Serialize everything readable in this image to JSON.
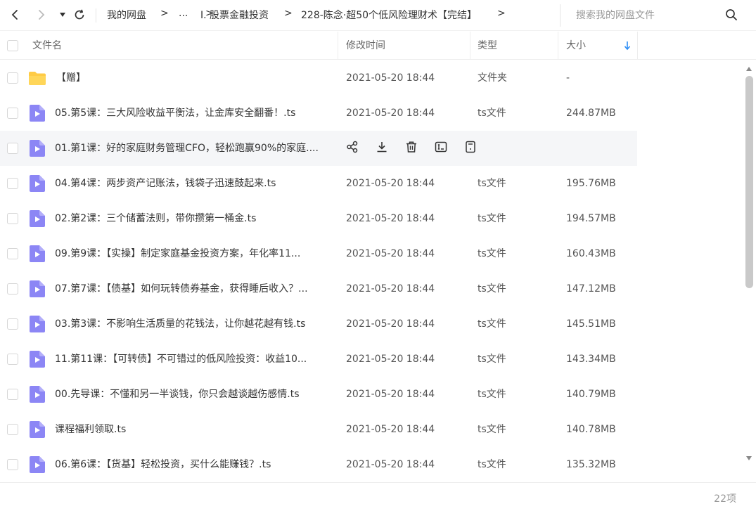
{
  "nav": {
    "breadcrumb": [
      "我的网盘",
      "...",
      "I. 股票金融投资",
      "228-陈念·超50个低风险理财术【完结】"
    ],
    "separator": ">"
  },
  "search": {
    "placeholder": "搜索我的网盘文件"
  },
  "table": {
    "headers": {
      "name": "文件名",
      "modified": "修改时间",
      "type": "类型",
      "size": "大小"
    },
    "rows": [
      {
        "name": "【赠】",
        "time": "2021-05-20 18:44",
        "type": "文件夹",
        "size": "-",
        "kind": "folder"
      },
      {
        "name": "05.第5课：三大风险收益平衡法，让金库安全翻番！.ts",
        "time": "2021-05-20 18:44",
        "type": "ts文件",
        "size": "244.87MB",
        "kind": "video"
      },
      {
        "name": "01.第1课：好的家庭财务管理CFO，轻松跑赢90%的家庭....",
        "time": "",
        "type": "",
        "size": "",
        "kind": "video",
        "hover": true
      },
      {
        "name": "04.第4课：两步资产记账法，钱袋子迅速鼓起来.ts",
        "time": "2021-05-20 18:44",
        "type": "ts文件",
        "size": "195.76MB",
        "kind": "video"
      },
      {
        "name": "02.第2课：三个储蓄法则，带你攒第一桶金.ts",
        "time": "2021-05-20 18:44",
        "type": "ts文件",
        "size": "194.57MB",
        "kind": "video"
      },
      {
        "name": "09.第9课：【实操】制定家庭基金投资方案，年化率11...",
        "time": "2021-05-20 18:44",
        "type": "ts文件",
        "size": "160.43MB",
        "kind": "video"
      },
      {
        "name": "07.第7课：【债基】如何玩转债券基金，获得睡后收入？...",
        "time": "2021-05-20 18:44",
        "type": "ts文件",
        "size": "147.12MB",
        "kind": "video"
      },
      {
        "name": "03.第3课：不影响生活质量的花钱法，让你越花越有钱.ts",
        "time": "2021-05-20 18:44",
        "type": "ts文件",
        "size": "145.51MB",
        "kind": "video"
      },
      {
        "name": "11.第11课：【可转债】不可错过的低风险投资：收益10...",
        "time": "2021-05-20 18:44",
        "type": "ts文件",
        "size": "143.34MB",
        "kind": "video"
      },
      {
        "name": "00.先导课：不懂和另一半谈钱，你只会越谈越伤感情.ts",
        "time": "2021-05-20 18:44",
        "type": "ts文件",
        "size": "140.79MB",
        "kind": "video"
      },
      {
        "name": "课程福利领取.ts",
        "time": "2021-05-20 18:44",
        "type": "ts文件",
        "size": "140.78MB",
        "kind": "video"
      },
      {
        "name": "06.第6课：【货基】轻松投资，买什么能赚钱？.ts",
        "time": "2021-05-20 18:44",
        "type": "ts文件",
        "size": "135.32MB",
        "kind": "video"
      }
    ]
  },
  "footer": {
    "count": "22项"
  },
  "colors": {
    "folder": "#ffcb45",
    "video": "#8c86f5",
    "sort_arrow": "#2b8cf5",
    "hover_row": "#f5f6f8"
  },
  "icons": {
    "row_actions": [
      "share-icon",
      "download-icon",
      "delete-icon",
      "rename-icon",
      "more-icon"
    ]
  }
}
